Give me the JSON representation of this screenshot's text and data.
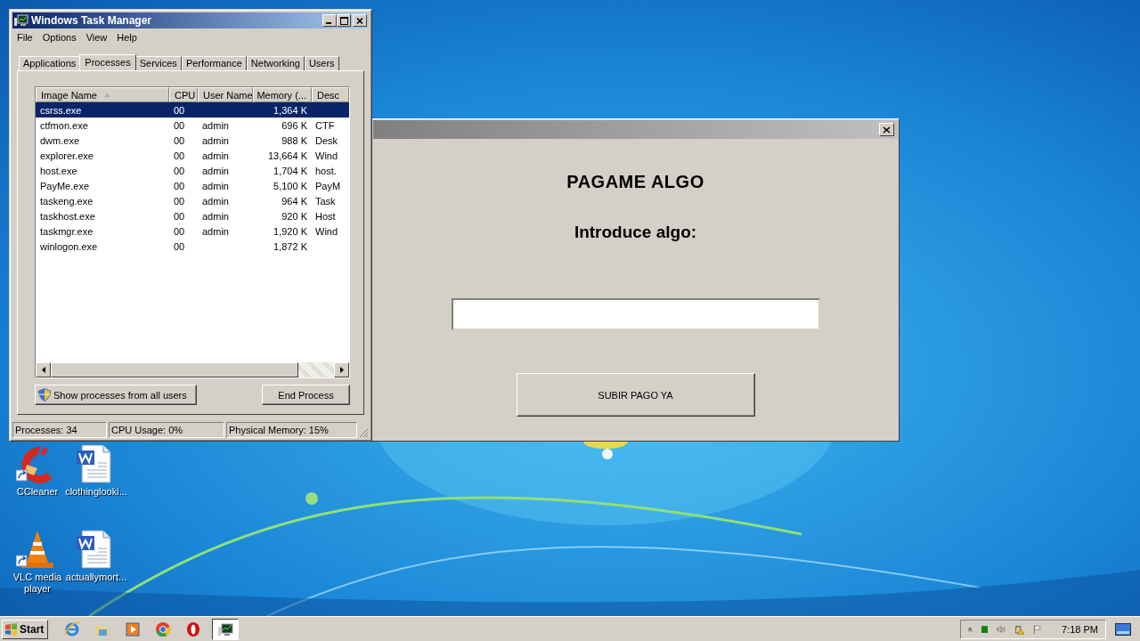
{
  "desktop_icons": [
    {
      "label": "CCleaner",
      "kind": "ccleaner"
    },
    {
      "label": "clothinglooki...",
      "kind": "word"
    },
    {
      "label": "VLC media player",
      "kind": "vlc"
    },
    {
      "label": "actuallymort...",
      "kind": "word"
    }
  ],
  "task_manager": {
    "title": "Windows Task Manager",
    "menu": [
      "File",
      "Options",
      "View",
      "Help"
    ],
    "tabs": [
      {
        "label": "Applications",
        "selected": false
      },
      {
        "label": "Processes",
        "selected": true
      },
      {
        "label": "Services",
        "selected": false
      },
      {
        "label": "Performance",
        "selected": false
      },
      {
        "label": "Networking",
        "selected": false
      },
      {
        "label": "Users",
        "selected": false
      }
    ],
    "columns": [
      {
        "label": "Image Name",
        "sorted": true
      },
      {
        "label": "CPU",
        "sorted": false
      },
      {
        "label": "User Name",
        "sorted": false
      },
      {
        "label": "Memory (...",
        "sorted": false
      },
      {
        "label": "Desc",
        "sorted": false
      }
    ],
    "rows": [
      {
        "cells": [
          "csrss.exe",
          "00",
          "",
          "1,364 K",
          ""
        ],
        "selected": true
      },
      {
        "cells": [
          "ctfmon.exe",
          "00",
          "admin",
          "696 K",
          "CTF"
        ],
        "selected": false
      },
      {
        "cells": [
          "dwm.exe",
          "00",
          "admin",
          "988 K",
          "Desk"
        ],
        "selected": false
      },
      {
        "cells": [
          "explorer.exe",
          "00",
          "admin",
          "13,664 K",
          "Wind"
        ],
        "selected": false
      },
      {
        "cells": [
          "host.exe",
          "00",
          "admin",
          "1,704 K",
          "host."
        ],
        "selected": false
      },
      {
        "cells": [
          "PayMe.exe",
          "00",
          "admin",
          "5,100 K",
          "PayM"
        ],
        "selected": false
      },
      {
        "cells": [
          "taskeng.exe",
          "00",
          "admin",
          "964 K",
          "Task"
        ],
        "selected": false
      },
      {
        "cells": [
          "taskhost.exe",
          "00",
          "admin",
          "920 K",
          "Host"
        ],
        "selected": false
      },
      {
        "cells": [
          "taskmgr.exe",
          "00",
          "admin",
          "1,920 K",
          "Wind"
        ],
        "selected": false
      },
      {
        "cells": [
          "winlogon.exe",
          "00",
          "",
          "1,872 K",
          ""
        ],
        "selected": false
      }
    ],
    "show_all_button": "Show processes from all users",
    "end_button": "End Process",
    "status_bar": [
      "Processes: 34",
      "CPU Usage: 0%",
      "Physical Memory: 15%"
    ]
  },
  "dialog": {
    "heading": "PAGAME ALGO",
    "prompt": "Introduce algo:",
    "button": "SUBIR PAGO YA"
  },
  "taskbar": {
    "start": "Start",
    "apps": [
      {
        "kind": "ie",
        "selected": false
      },
      {
        "kind": "folder",
        "selected": false
      },
      {
        "kind": "media",
        "selected": false
      },
      {
        "kind": "chrome",
        "selected": false
      },
      {
        "kind": "opera",
        "selected": false
      },
      {
        "kind": "taskmgr",
        "selected": true
      }
    ],
    "clock": "7:18 PM"
  }
}
